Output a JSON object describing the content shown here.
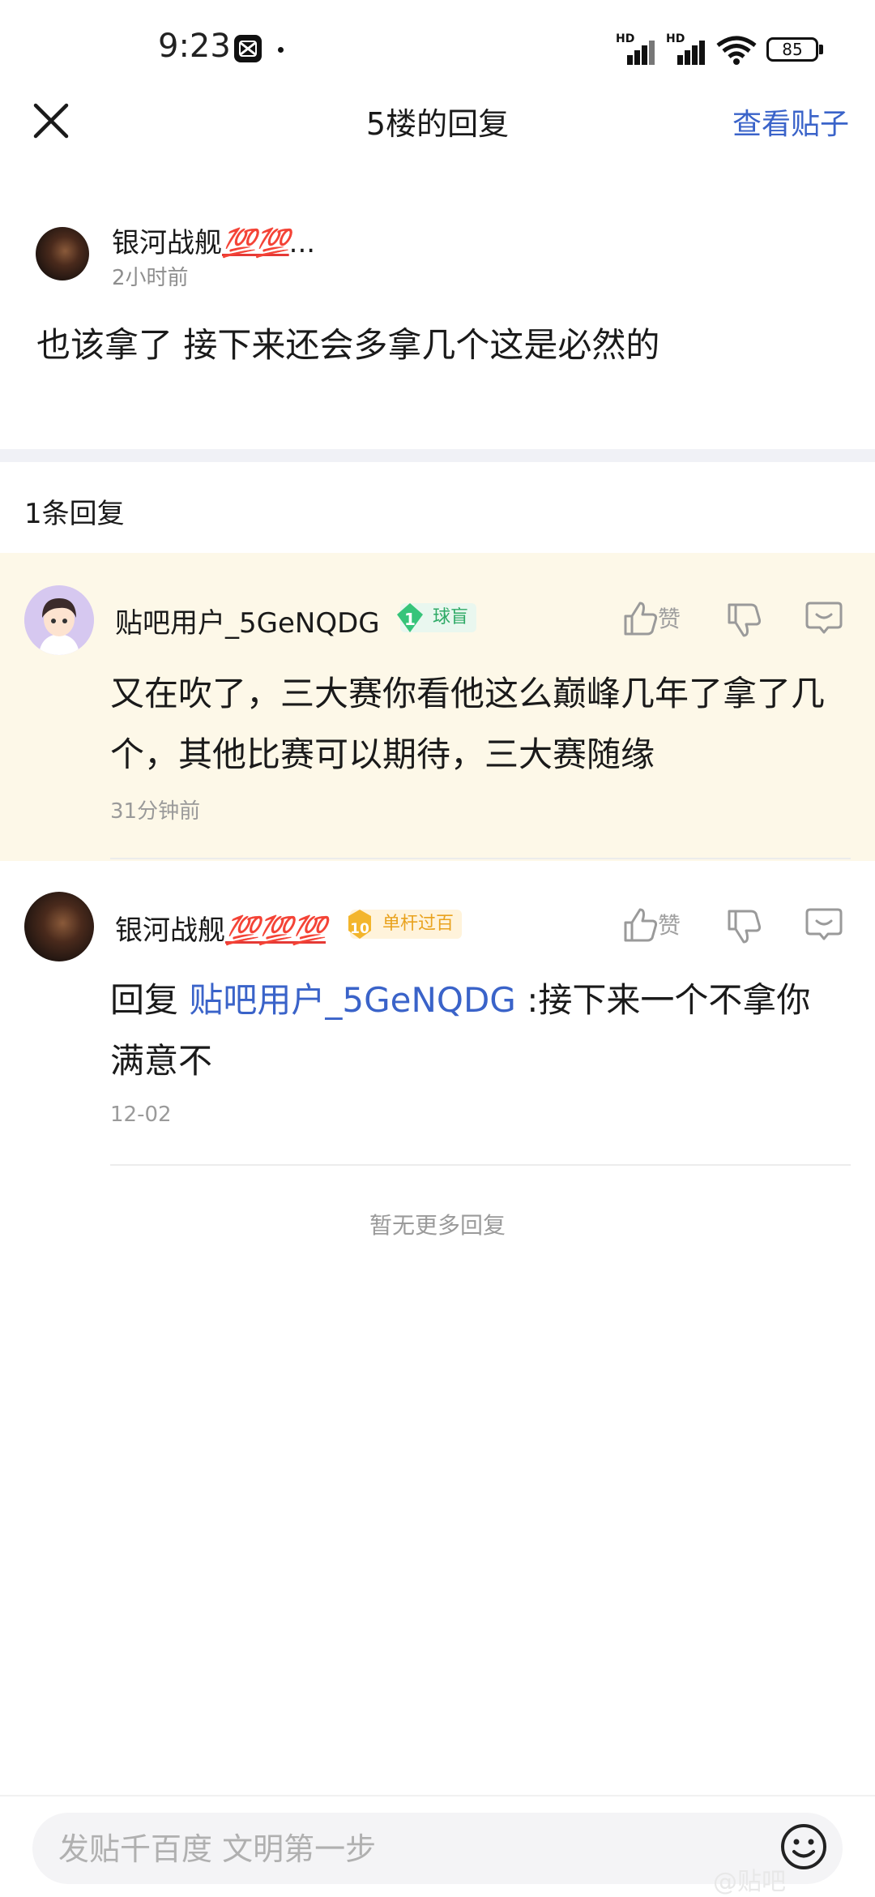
{
  "status_bar": {
    "time": "9:23",
    "battery": "85",
    "signal_label": "HD"
  },
  "header": {
    "title": "5楼的回复",
    "view_post": "查看贴子"
  },
  "main_post": {
    "author": "银河战舰",
    "author_emoji": "💯💯",
    "author_ellipsis": "...",
    "time": "2小时前",
    "content": "也该拿了 接下来还会多拿几个这是必然的"
  },
  "reply_count": "1条回复",
  "replies": [
    {
      "author": "贴吧用户_5GeNQDG",
      "level": "1",
      "badge_title": "球盲",
      "like_label": "赞",
      "content_line1": "又在吹了，三大赛你看他这么巅峰几年了拿了几",
      "content_line2": "个，其他比赛可以期待，三大赛随缘",
      "time": "31分钟前"
    },
    {
      "author": "银河战舰",
      "author_emoji": "💯💯💯",
      "level": "10",
      "badge_title": "单杆过百",
      "like_label": "赞",
      "reply_prefix": "回复 ",
      "mention": "贴吧用户_5GeNQDG",
      "content_line1": " :接下来一个不拿你",
      "content_line2": "满意不",
      "time": "12-02"
    }
  ],
  "no_more": "暂无更多回复",
  "composer": {
    "placeholder": "发贴千百度 文明第一步"
  },
  "watermark": "@贴吧"
}
